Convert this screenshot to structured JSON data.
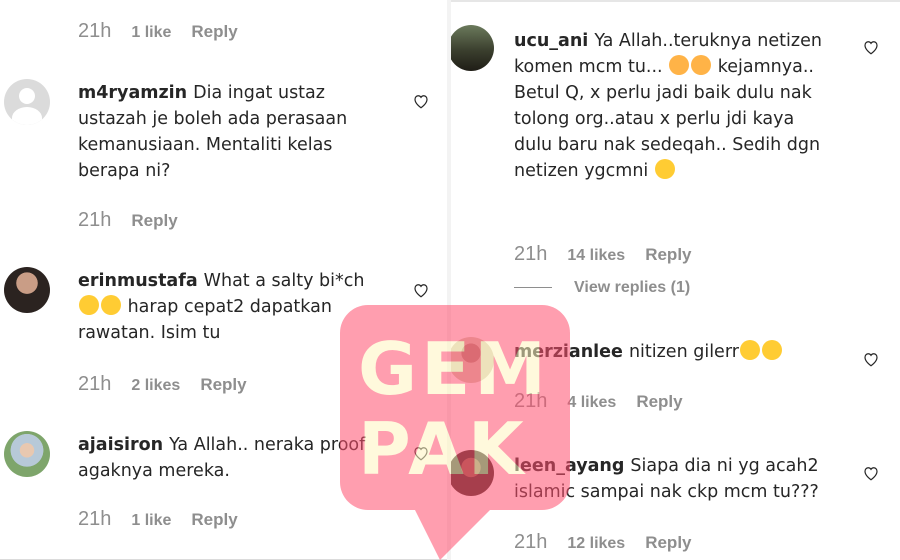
{
  "left": {
    "top_meta": {
      "time": "21h",
      "likes": "1 like",
      "reply": "Reply"
    },
    "comments": [
      {
        "username": "m4ryamzin",
        "text": "Dia ingat ustaz ustazah je boleh ada perasaan kemanusiaan. Mentaliti kelas berapa ni?",
        "time": "21h",
        "likes": "",
        "reply": "Reply",
        "avatar": "default-avatar"
      },
      {
        "username": "erinmustafa",
        "text_a": "What a salty bi*ch",
        "text_b": "harap cepat2 dapatkan rawatan. Isim tu",
        "emojis": [
          "laughing-emoji",
          "laughing-emoji"
        ],
        "time": "21h",
        "likes": "2 likes",
        "reply": "Reply"
      },
      {
        "username": "ajaisiron",
        "text": "Ya Allah.. neraka proof agaknya mereka.",
        "time": "21h",
        "likes": "1 like",
        "reply": "Reply"
      }
    ]
  },
  "right": {
    "comments": [
      {
        "username": "ucu_ani",
        "text_a": "Ya Allah..teruknya netizen komen mcm tu...",
        "text_b": "kejamnya.. Betul Q, x perlu jadi baik dulu nak tolong org..atau x perlu jdi kaya dulu baru nak sedeqah.. Sedih dgn netizen ygcmni",
        "emojis_a": [
          "shocked-emoji",
          "shocked-emoji"
        ],
        "emojis_b": [
          "sad-emoji"
        ],
        "time": "21h",
        "likes": "14 likes",
        "reply": "Reply",
        "view_replies": "View replies (1)"
      },
      {
        "username": "merzianlee",
        "text": "nitizen gilerr",
        "emojis": [
          "rofl-emoji",
          "rofl-emoji"
        ],
        "time": "21h",
        "likes": "4 likes",
        "reply": "Reply"
      },
      {
        "username": "leen_ayang",
        "text": "Siapa dia ni yg acah2 islamic sampai nak ckp mcm tu???",
        "time": "21h",
        "likes": "12 likes",
        "reply": "Reply"
      }
    ]
  },
  "watermark": {
    "line1": "GEM",
    "line2": "PAK",
    "color": "#ff4f6e"
  },
  "colors": {
    "text": "#262626",
    "meta": "#8e8e8e",
    "emoji": "#ffcc33"
  }
}
